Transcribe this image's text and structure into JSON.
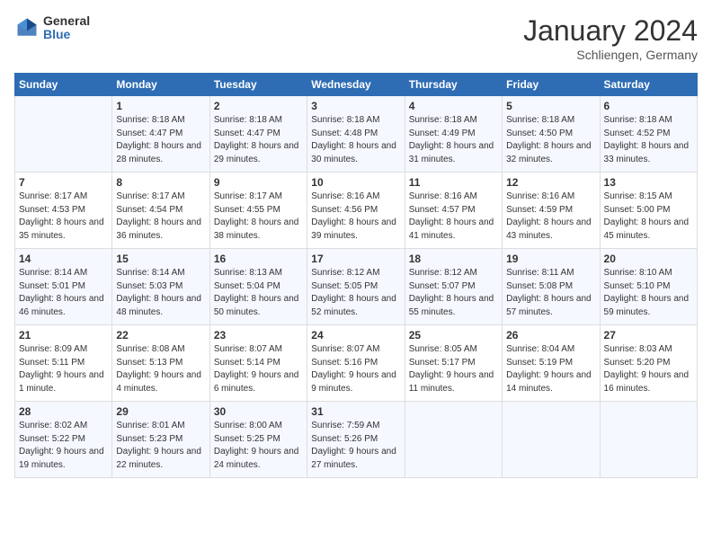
{
  "header": {
    "logo_general": "General",
    "logo_blue": "Blue",
    "month_title": "January 2024",
    "subtitle": "Schliengen, Germany"
  },
  "days_of_week": [
    "Sunday",
    "Monday",
    "Tuesday",
    "Wednesday",
    "Thursday",
    "Friday",
    "Saturday"
  ],
  "weeks": [
    [
      {
        "num": "",
        "sunrise": "",
        "sunset": "",
        "daylight": "",
        "empty": true
      },
      {
        "num": "1",
        "sunrise": "Sunrise: 8:18 AM",
        "sunset": "Sunset: 4:47 PM",
        "daylight": "Daylight: 8 hours and 28 minutes.",
        "empty": false
      },
      {
        "num": "2",
        "sunrise": "Sunrise: 8:18 AM",
        "sunset": "Sunset: 4:47 PM",
        "daylight": "Daylight: 8 hours and 29 minutes.",
        "empty": false
      },
      {
        "num": "3",
        "sunrise": "Sunrise: 8:18 AM",
        "sunset": "Sunset: 4:48 PM",
        "daylight": "Daylight: 8 hours and 30 minutes.",
        "empty": false
      },
      {
        "num": "4",
        "sunrise": "Sunrise: 8:18 AM",
        "sunset": "Sunset: 4:49 PM",
        "daylight": "Daylight: 8 hours and 31 minutes.",
        "empty": false
      },
      {
        "num": "5",
        "sunrise": "Sunrise: 8:18 AM",
        "sunset": "Sunset: 4:50 PM",
        "daylight": "Daylight: 8 hours and 32 minutes.",
        "empty": false
      },
      {
        "num": "6",
        "sunrise": "Sunrise: 8:18 AM",
        "sunset": "Sunset: 4:52 PM",
        "daylight": "Daylight: 8 hours and 33 minutes.",
        "empty": false
      }
    ],
    [
      {
        "num": "7",
        "sunrise": "Sunrise: 8:17 AM",
        "sunset": "Sunset: 4:53 PM",
        "daylight": "Daylight: 8 hours and 35 minutes.",
        "empty": false
      },
      {
        "num": "8",
        "sunrise": "Sunrise: 8:17 AM",
        "sunset": "Sunset: 4:54 PM",
        "daylight": "Daylight: 8 hours and 36 minutes.",
        "empty": false
      },
      {
        "num": "9",
        "sunrise": "Sunrise: 8:17 AM",
        "sunset": "Sunset: 4:55 PM",
        "daylight": "Daylight: 8 hours and 38 minutes.",
        "empty": false
      },
      {
        "num": "10",
        "sunrise": "Sunrise: 8:16 AM",
        "sunset": "Sunset: 4:56 PM",
        "daylight": "Daylight: 8 hours and 39 minutes.",
        "empty": false
      },
      {
        "num": "11",
        "sunrise": "Sunrise: 8:16 AM",
        "sunset": "Sunset: 4:57 PM",
        "daylight": "Daylight: 8 hours and 41 minutes.",
        "empty": false
      },
      {
        "num": "12",
        "sunrise": "Sunrise: 8:16 AM",
        "sunset": "Sunset: 4:59 PM",
        "daylight": "Daylight: 8 hours and 43 minutes.",
        "empty": false
      },
      {
        "num": "13",
        "sunrise": "Sunrise: 8:15 AM",
        "sunset": "Sunset: 5:00 PM",
        "daylight": "Daylight: 8 hours and 45 minutes.",
        "empty": false
      }
    ],
    [
      {
        "num": "14",
        "sunrise": "Sunrise: 8:14 AM",
        "sunset": "Sunset: 5:01 PM",
        "daylight": "Daylight: 8 hours and 46 minutes.",
        "empty": false
      },
      {
        "num": "15",
        "sunrise": "Sunrise: 8:14 AM",
        "sunset": "Sunset: 5:03 PM",
        "daylight": "Daylight: 8 hours and 48 minutes.",
        "empty": false
      },
      {
        "num": "16",
        "sunrise": "Sunrise: 8:13 AM",
        "sunset": "Sunset: 5:04 PM",
        "daylight": "Daylight: 8 hours and 50 minutes.",
        "empty": false
      },
      {
        "num": "17",
        "sunrise": "Sunrise: 8:12 AM",
        "sunset": "Sunset: 5:05 PM",
        "daylight": "Daylight: 8 hours and 52 minutes.",
        "empty": false
      },
      {
        "num": "18",
        "sunrise": "Sunrise: 8:12 AM",
        "sunset": "Sunset: 5:07 PM",
        "daylight": "Daylight: 8 hours and 55 minutes.",
        "empty": false
      },
      {
        "num": "19",
        "sunrise": "Sunrise: 8:11 AM",
        "sunset": "Sunset: 5:08 PM",
        "daylight": "Daylight: 8 hours and 57 minutes.",
        "empty": false
      },
      {
        "num": "20",
        "sunrise": "Sunrise: 8:10 AM",
        "sunset": "Sunset: 5:10 PM",
        "daylight": "Daylight: 8 hours and 59 minutes.",
        "empty": false
      }
    ],
    [
      {
        "num": "21",
        "sunrise": "Sunrise: 8:09 AM",
        "sunset": "Sunset: 5:11 PM",
        "daylight": "Daylight: 9 hours and 1 minute.",
        "empty": false
      },
      {
        "num": "22",
        "sunrise": "Sunrise: 8:08 AM",
        "sunset": "Sunset: 5:13 PM",
        "daylight": "Daylight: 9 hours and 4 minutes.",
        "empty": false
      },
      {
        "num": "23",
        "sunrise": "Sunrise: 8:07 AM",
        "sunset": "Sunset: 5:14 PM",
        "daylight": "Daylight: 9 hours and 6 minutes.",
        "empty": false
      },
      {
        "num": "24",
        "sunrise": "Sunrise: 8:07 AM",
        "sunset": "Sunset: 5:16 PM",
        "daylight": "Daylight: 9 hours and 9 minutes.",
        "empty": false
      },
      {
        "num": "25",
        "sunrise": "Sunrise: 8:05 AM",
        "sunset": "Sunset: 5:17 PM",
        "daylight": "Daylight: 9 hours and 11 minutes.",
        "empty": false
      },
      {
        "num": "26",
        "sunrise": "Sunrise: 8:04 AM",
        "sunset": "Sunset: 5:19 PM",
        "daylight": "Daylight: 9 hours and 14 minutes.",
        "empty": false
      },
      {
        "num": "27",
        "sunrise": "Sunrise: 8:03 AM",
        "sunset": "Sunset: 5:20 PM",
        "daylight": "Daylight: 9 hours and 16 minutes.",
        "empty": false
      }
    ],
    [
      {
        "num": "28",
        "sunrise": "Sunrise: 8:02 AM",
        "sunset": "Sunset: 5:22 PM",
        "daylight": "Daylight: 9 hours and 19 minutes.",
        "empty": false
      },
      {
        "num": "29",
        "sunrise": "Sunrise: 8:01 AM",
        "sunset": "Sunset: 5:23 PM",
        "daylight": "Daylight: 9 hours and 22 minutes.",
        "empty": false
      },
      {
        "num": "30",
        "sunrise": "Sunrise: 8:00 AM",
        "sunset": "Sunset: 5:25 PM",
        "daylight": "Daylight: 9 hours and 24 minutes.",
        "empty": false
      },
      {
        "num": "31",
        "sunrise": "Sunrise: 7:59 AM",
        "sunset": "Sunset: 5:26 PM",
        "daylight": "Daylight: 9 hours and 27 minutes.",
        "empty": false
      },
      {
        "num": "",
        "sunrise": "",
        "sunset": "",
        "daylight": "",
        "empty": true
      },
      {
        "num": "",
        "sunrise": "",
        "sunset": "",
        "daylight": "",
        "empty": true
      },
      {
        "num": "",
        "sunrise": "",
        "sunset": "",
        "daylight": "",
        "empty": true
      }
    ]
  ]
}
